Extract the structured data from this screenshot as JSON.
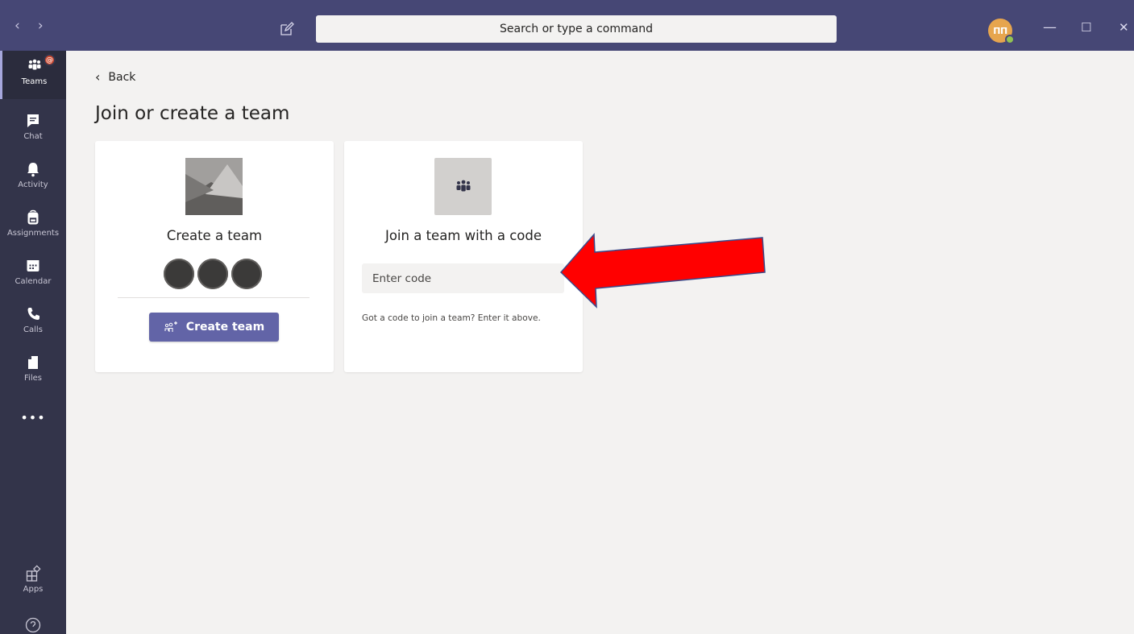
{
  "titlebar": {
    "back_arrow": "‹",
    "forward_arrow": "›",
    "search_placeholder": "Search or type a command",
    "avatar_initials": "ПП",
    "minimize": "—",
    "maximize": "☐",
    "close": "✕"
  },
  "rail": {
    "items": [
      {
        "label": "Teams",
        "icon": "teams-icon",
        "active": true,
        "mention_badge": "@"
      },
      {
        "label": "Chat",
        "icon": "chat-icon"
      },
      {
        "label": "Activity",
        "icon": "bell-icon"
      },
      {
        "label": "Assignments",
        "icon": "backpack-icon"
      },
      {
        "label": "Calendar",
        "icon": "calendar-icon"
      },
      {
        "label": "Calls",
        "icon": "phone-icon"
      },
      {
        "label": "Files",
        "icon": "file-icon"
      },
      {
        "label": "•••",
        "icon": "more-icon"
      }
    ],
    "apps_label": "Apps",
    "help_icon": "help-icon"
  },
  "main": {
    "back_label": "Back",
    "title": "Join or create a team",
    "create_card": {
      "title": "Create a team",
      "button_label": "Create team"
    },
    "join_card": {
      "title": "Join a team with a code",
      "input_placeholder": "Enter code",
      "hint": "Got a code to join a team? Enter it above."
    }
  },
  "colors": {
    "titlebar": "#464775",
    "rail": "#33344a",
    "accent": "#6264a7",
    "annotation_arrow": "#ff0000"
  }
}
